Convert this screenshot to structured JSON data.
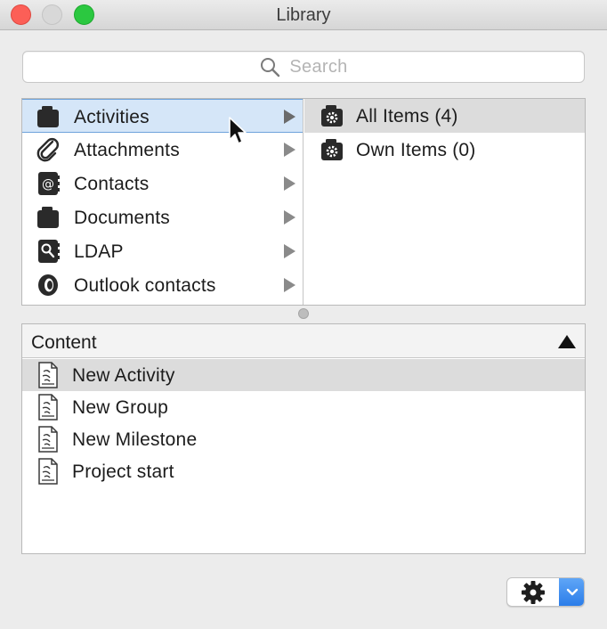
{
  "window": {
    "title": "Library"
  },
  "search": {
    "placeholder": "Search"
  },
  "categories": [
    {
      "label": "Activities",
      "icon": "folder-icon",
      "selected": true
    },
    {
      "label": "Attachments",
      "icon": "paperclip-icon",
      "selected": false
    },
    {
      "label": "Contacts",
      "icon": "address-book-icon",
      "selected": false
    },
    {
      "label": "Documents",
      "icon": "folder-icon",
      "selected": false
    },
    {
      "label": "LDAP",
      "icon": "ldap-search-icon",
      "selected": false
    },
    {
      "label": "Outlook contacts",
      "icon": "outlook-icon",
      "selected": false
    }
  ],
  "subcategories": [
    {
      "label": "All Items (4)",
      "icon": "smart-folder-icon",
      "selected": true
    },
    {
      "label": "Own Items (0)",
      "icon": "smart-folder-icon",
      "selected": false
    }
  ],
  "content": {
    "header": "Content",
    "sort": "ascending",
    "items": [
      {
        "label": "New Activity",
        "icon": "template-document-icon",
        "selected": true
      },
      {
        "label": "New Group",
        "icon": "template-document-icon",
        "selected": false
      },
      {
        "label": "New Milestone",
        "icon": "template-document-icon",
        "selected": false
      },
      {
        "label": "Project start",
        "icon": "template-document-icon",
        "selected": false
      }
    ]
  },
  "toolbar": {
    "action_icon": "gear-icon",
    "menu_icon": "chevron-down-icon"
  },
  "colors": {
    "selection_blue": "#d5e6f8",
    "selection_gray": "#dcdcdc",
    "accent_blue": "#2b7de9"
  }
}
